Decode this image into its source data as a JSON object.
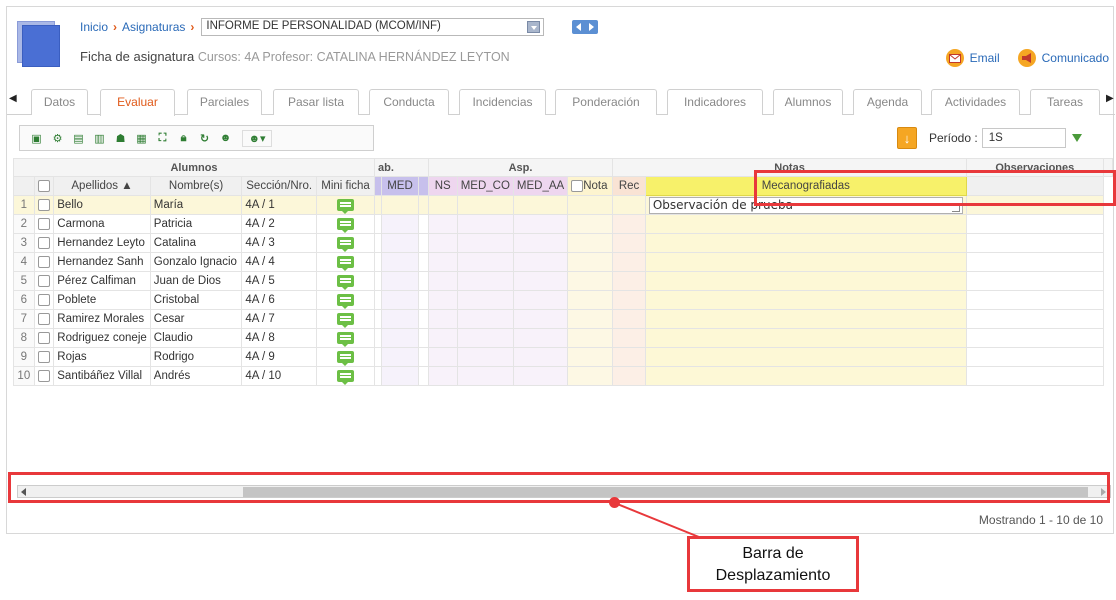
{
  "breadcrumb": {
    "home": "Inicio",
    "section": "Asignaturas",
    "subject_select": "INFORME DE PERSONALIDAD (MCOM/INF)"
  },
  "header": {
    "title": "Ficha de asignatura",
    "meta": "Cursos: 4A Profesor: CATALINA HERNÁNDEZ LEYTON",
    "email_label": "Email",
    "notice_label": "Comunicado"
  },
  "tabs": [
    "Datos",
    "Evaluar",
    "Parciales",
    "Pasar lista",
    "Conducta",
    "Incidencias",
    "Ponderación",
    "Indicadores",
    "Alumnos",
    "Agenda",
    "Actividades",
    "Tareas"
  ],
  "active_tab": "Evaluar",
  "toolbar_icons": [
    "save-icon",
    "settings-icon",
    "excel-export-icon",
    "excel-import-icon",
    "students-icon",
    "calculator-icon",
    "expand-icon",
    "lock-icon",
    "refresh-icon",
    "user-search-icon",
    "user-forward-dropdown-icon"
  ],
  "period": {
    "label": "Período :",
    "value": "1S"
  },
  "grid": {
    "groups": {
      "alumnos": "Alumnos",
      "hab": "ab.",
      "asp": "Asp.",
      "notas": "Notas",
      "obs": "Observaciones"
    },
    "columns": {
      "apellidos": "Apellidos ▲",
      "nombres": "Nombre(s)",
      "seccion": "Sección/Nro.",
      "mini": "Mini ficha",
      "med": "MED",
      "ns": "NS",
      "med_co": "MED_CO",
      "med_aa": "MED_AA",
      "nota": "Nota",
      "rec": "Rec",
      "obs": "Mecanografiadas"
    },
    "rows": [
      {
        "n": "1",
        "apellidos": "Bello",
        "nombre": "María",
        "seccion": "4A / 1"
      },
      {
        "n": "2",
        "apellidos": "Carmona",
        "nombre": "Patricia",
        "seccion": "4A / 2"
      },
      {
        "n": "3",
        "apellidos": "Hernandez Leyto",
        "nombre": "Catalina",
        "seccion": "4A / 3"
      },
      {
        "n": "4",
        "apellidos": "Hernandez Sanh",
        "nombre": "Gonzalo Ignacio",
        "seccion": "4A / 4"
      },
      {
        "n": "5",
        "apellidos": "Pérez Calfiman",
        "nombre": "Juan de Dios",
        "seccion": "4A / 5"
      },
      {
        "n": "6",
        "apellidos": "Poblete",
        "nombre": "Cristobal",
        "seccion": "4A / 6"
      },
      {
        "n": "7",
        "apellidos": "Ramirez Morales",
        "nombre": "Cesar",
        "seccion": "4A / 7"
      },
      {
        "n": "8",
        "apellidos": "Rodriguez coneje",
        "nombre": "Claudio",
        "seccion": "4A / 8"
      },
      {
        "n": "9",
        "apellidos": "Rojas",
        "nombre": "Rodrigo",
        "seccion": "4A / 9"
      },
      {
        "n": "10",
        "apellidos": "Santibáñez Villal",
        "nombre": "Andrés",
        "seccion": "4A / 10"
      }
    ],
    "observation_value": "Observación de prueba"
  },
  "status_text": "Mostrando 1 - 10 de 10",
  "annotation": {
    "line1": "Barra de",
    "line2": "Desplazamiento"
  },
  "colors": {
    "accent": "#e05a1a",
    "link": "#2a6ab8",
    "highlight": "#e8383b",
    "obs_header": "#f7f16a"
  }
}
